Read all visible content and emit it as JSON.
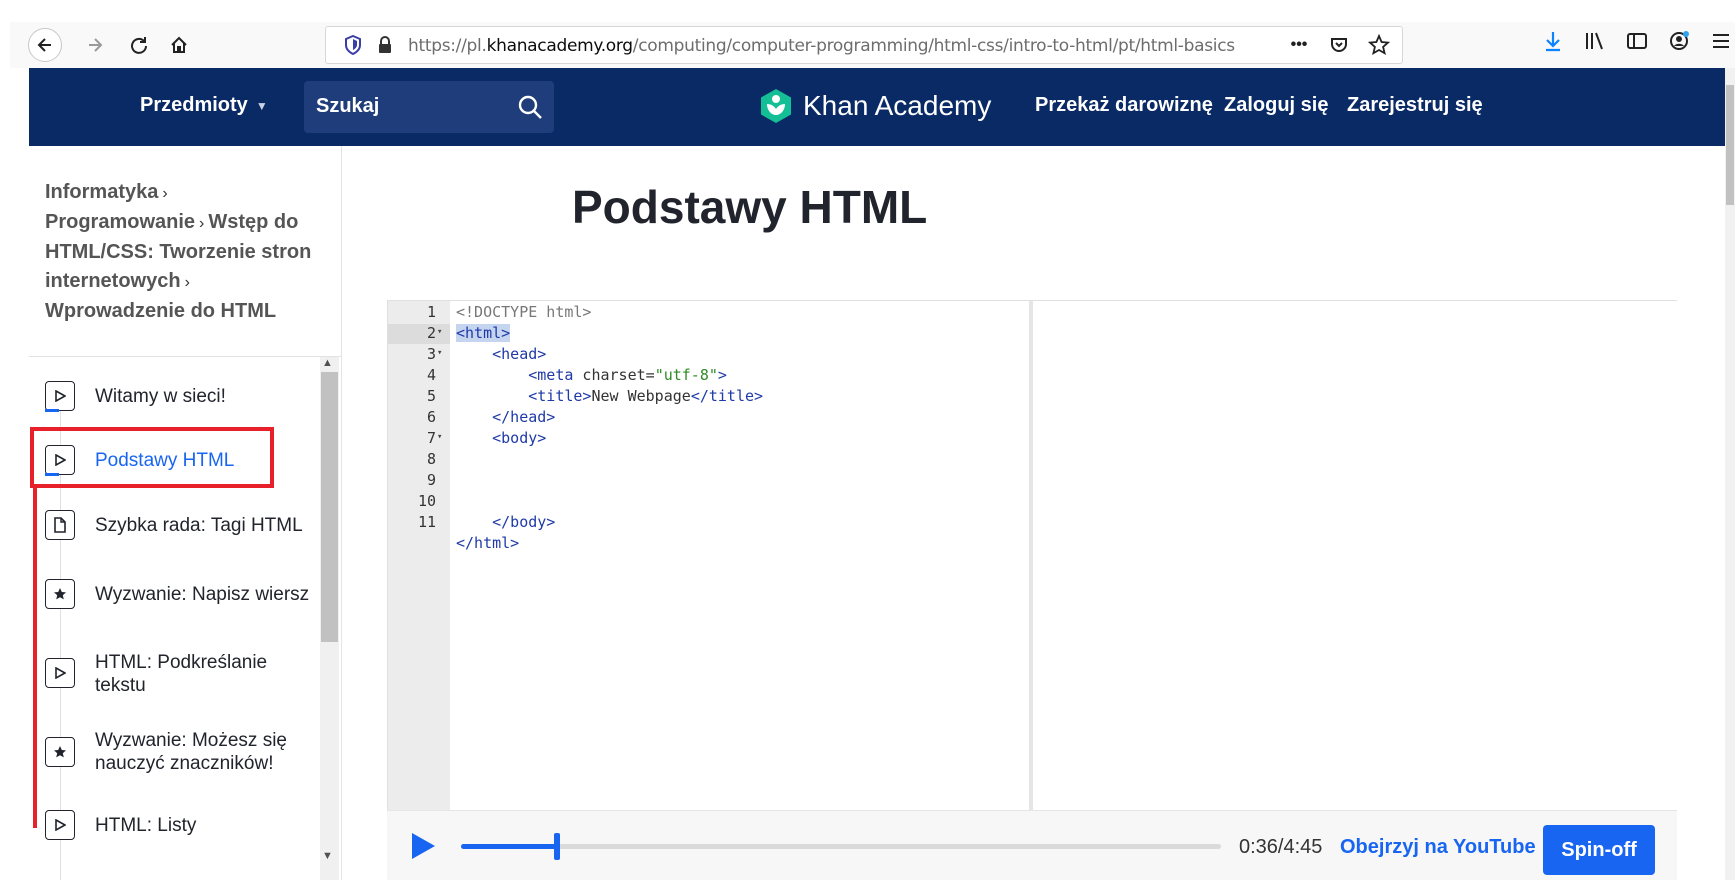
{
  "browser": {
    "url_prefix": "https://pl.",
    "url_domain": "khanacademy.org",
    "url_path": "/computing/computer-programming/html-css/intro-to-html/pt/html-basics",
    "page_actions": "•••"
  },
  "header": {
    "subjects_label": "Przedmioty",
    "search_label": "Szukaj",
    "logo_text": "Khan Academy",
    "donate_label": "Przekaż darowiznę",
    "login_label": "Zaloguj się",
    "signup_label": "Zarejestruj się"
  },
  "breadcrumb": {
    "items": [
      "Informatyka",
      "Programowanie",
      "Wstęp do HTML/CSS: Tworzenie stron internetowych",
      "Wprowadzenie do HTML"
    ]
  },
  "lessons": [
    {
      "label": "Witamy w sieci!",
      "icon": "play-icon",
      "active": false
    },
    {
      "label": "Podstawy HTML",
      "icon": "play-icon",
      "active": true
    },
    {
      "label": "Szybka rada: Tagi HTML",
      "icon": "document-icon",
      "active": false
    },
    {
      "label": "Wyzwanie: Napisz wiersz",
      "icon": "star-icon",
      "active": false
    },
    {
      "label": "HTML: Podkreślanie tekstu",
      "icon": "play-icon",
      "active": false
    },
    {
      "label": "Wyzwanie: Możesz się nauczyć znaczników!",
      "icon": "star-icon",
      "active": false
    },
    {
      "label": "HTML: Listy",
      "icon": "play-icon",
      "active": false
    }
  ],
  "main": {
    "title": "Podstawy HTML"
  },
  "code": {
    "line_numbers": [
      "1",
      "2",
      "3",
      "4",
      "5",
      "6",
      "7",
      "8",
      "9",
      "10",
      "11"
    ],
    "lines": [
      "<!DOCTYPE html>",
      "<html>",
      "    <head>",
      "        <meta charset=\"utf-8\">",
      "        <title>New Webpage</title>",
      "    </head>",
      "    <body>",
      "",
      "",
      "    </body>",
      "</html>"
    ]
  },
  "player": {
    "time": "0:36/4:45",
    "progress_fraction": 0.126,
    "youtube_label": "Obejrzyj na YouTube",
    "spinoff_label": "Spin-off"
  },
  "colors": {
    "header_bg": "#0a2a66",
    "accent": "#1865f2",
    "annotation": "#e8202a",
    "logo_green": "#14bf96"
  }
}
